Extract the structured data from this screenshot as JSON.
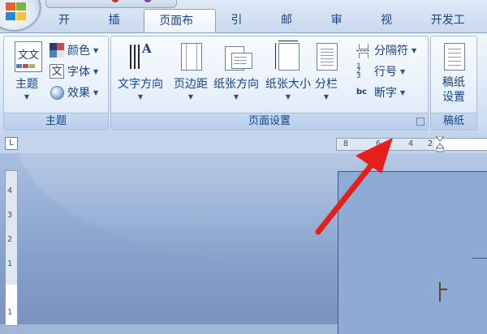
{
  "tabs": [
    {
      "label": "开始"
    },
    {
      "label": "插入"
    },
    {
      "label": "页面布局"
    },
    {
      "label": "引用"
    },
    {
      "label": "邮件"
    },
    {
      "label": "审阅"
    },
    {
      "label": "视图"
    },
    {
      "label": "开发工具"
    }
  ],
  "active_tab": "页面布局",
  "ribbon": {
    "theme_group": {
      "label": "主题",
      "themes_button": "主题",
      "colors": "颜色",
      "fonts": "字体",
      "effects": "效果",
      "theme_icon_text": "文文"
    },
    "page_setup_group": {
      "label": "页面设置",
      "text_direction": "文字方向",
      "margins": "页边距",
      "orientation": "纸张方向",
      "size": "纸张大小",
      "columns": "分栏",
      "breaks": "分隔符",
      "line_numbers": "行号",
      "hyphenation": "断字",
      "text_direction_glyph": "A",
      "hyphenation_glyph": "bc"
    },
    "draft_paper_group": {
      "label": "稿纸",
      "draft_settings": "稿纸设置"
    }
  },
  "ruler": {
    "toggle": "L",
    "h_ticks": [
      "8",
      "6",
      "4",
      "2"
    ],
    "v_ticks": [
      "4",
      "3",
      "2",
      "1",
      "1"
    ]
  },
  "colors": {
    "accent_text": "#15428b",
    "ribbon_bg": "#dbe7f6",
    "arrow": "#e3201c",
    "canvas": "#86a2cc"
  }
}
